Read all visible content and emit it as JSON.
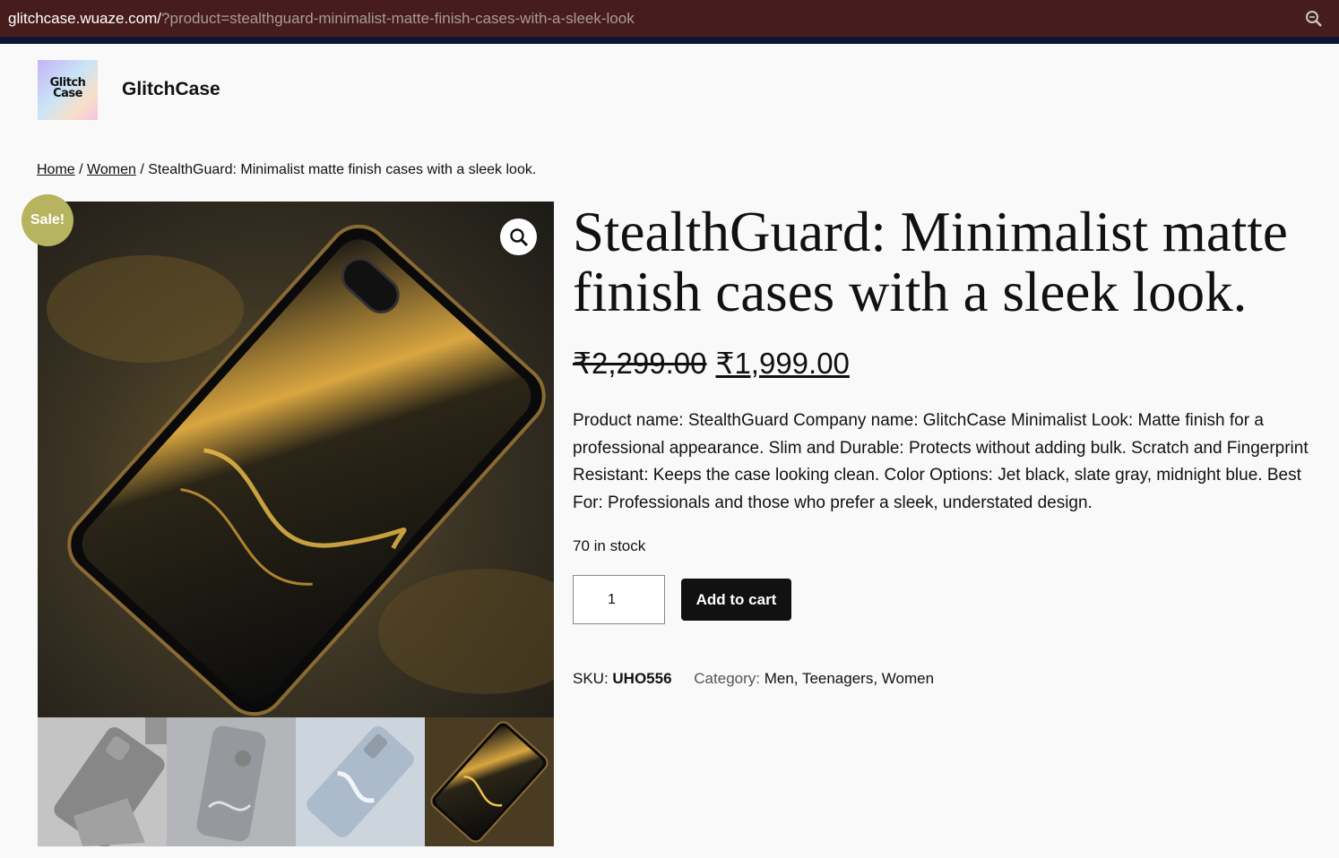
{
  "browser": {
    "url_host": "glitchcase.wuaze.com/",
    "url_path": "?product=stealthguard-minimalist-matte-finish-cases-with-a-sleek-look",
    "zoom_icon": "zoom-icon"
  },
  "site": {
    "logo_line1": "Glitch",
    "logo_line2": "Case",
    "title": "GlitchCase"
  },
  "breadcrumb": {
    "home": "Home",
    "sep1": " / ",
    "category": "Women",
    "sep2": " / ",
    "current": "StealthGuard: Minimalist matte finish cases with a sleek look."
  },
  "gallery": {
    "sale_badge": "Sale!",
    "zoom_icon": "magnifier-icon"
  },
  "product": {
    "title": "StealthGuard: Minimalist matte finish cases with a sleek look.",
    "regular_price": "₹2,299.00",
    "sale_price": "₹1,999.00",
    "description": "Product name: StealthGuard  Company name: GlitchCase Minimalist Look: Matte finish for a professional appearance. Slim and Durable: Protects without adding bulk. Scratch and Fingerprint Resistant: Keeps the case looking clean. Color Options: Jet black, slate gray, midnight blue. Best For: Professionals and those who prefer a sleek, understated design.",
    "stock": "70 in stock",
    "quantity": "1",
    "add_to_cart": "Add to cart",
    "sku_label": "SKU: ",
    "sku": "UHO556",
    "category_label": "Category: ",
    "categories": [
      "Men",
      "Teenagers",
      "Women"
    ],
    "category_sep": ", "
  },
  "colors": {
    "urlbar": "#471c1c",
    "sale_badge": "#b6b45e",
    "button": "#111111"
  }
}
